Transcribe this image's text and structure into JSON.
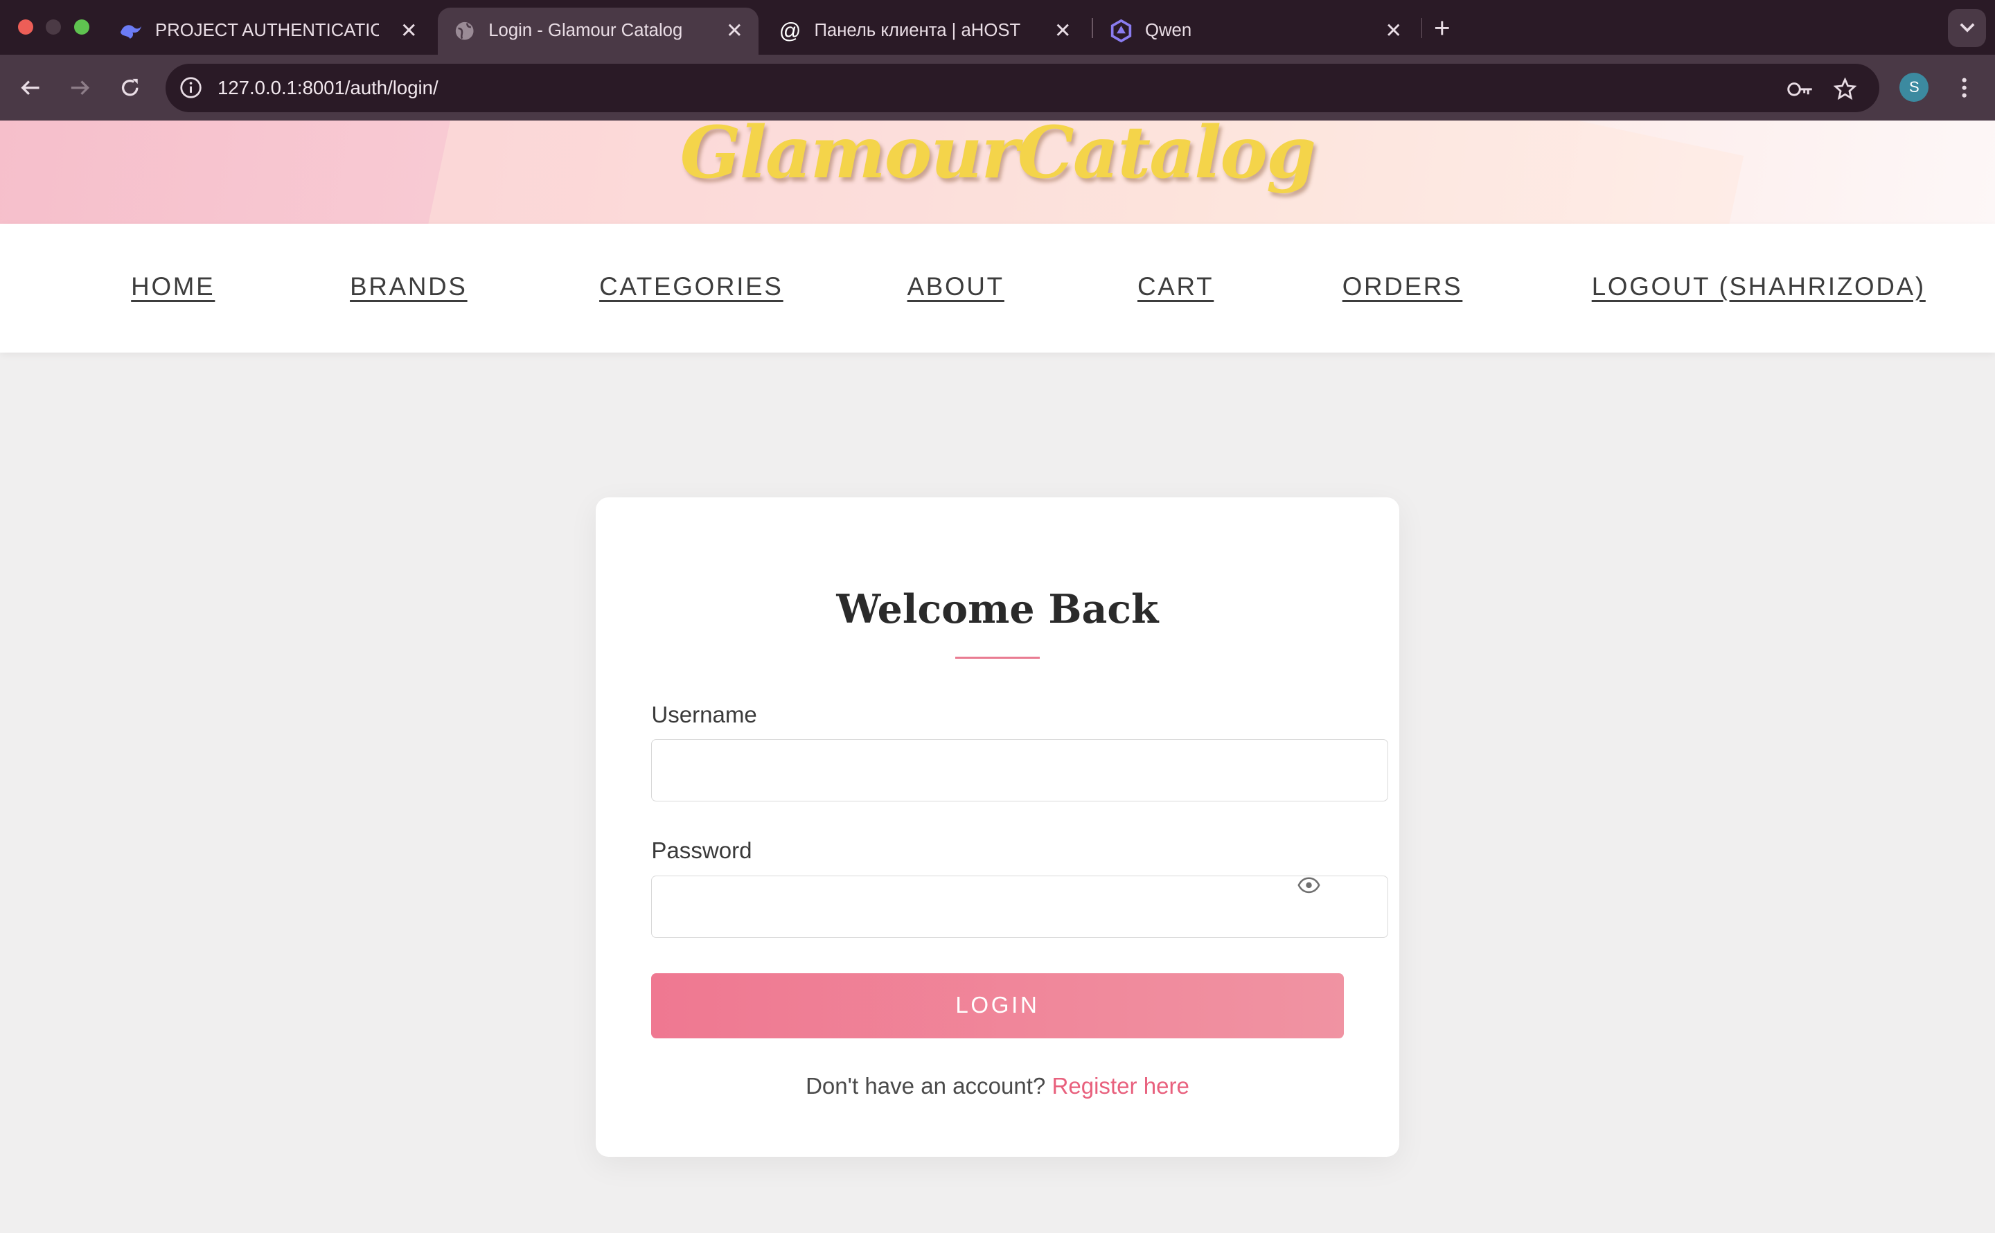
{
  "browser": {
    "tabs": [
      {
        "title": "PROJECT AUTHENTICATION",
        "icon": "deepseek-icon",
        "active": false
      },
      {
        "title": "Login - Glamour Catalog",
        "icon": "globe-icon",
        "active": true
      },
      {
        "title": "Панель клиента | aHOST",
        "icon": "at-sign-icon",
        "active": false
      },
      {
        "title": "Qwen",
        "icon": "qwen-icon",
        "active": false
      }
    ],
    "url": "127.0.0.1:8001/auth/login/",
    "profile_initial": "S"
  },
  "site": {
    "logo": "GlamourCatalog",
    "nav": [
      "HOME",
      "BRANDS",
      "CATEGORIES",
      "ABOUT",
      "CART",
      "ORDERS",
      "LOGOUT (SHAHRIZODA)"
    ]
  },
  "login": {
    "title": "Welcome Back",
    "username_label": "Username",
    "username_value": "",
    "password_label": "Password",
    "password_value": "",
    "button_label": "LOGIN",
    "register_prompt": "Don't have an account?",
    "register_link": "Register here"
  },
  "colors": {
    "accent": "#ef7891",
    "link": "#e8607d",
    "logo": "#f4d44a",
    "tabbar": "#2a1a26",
    "toolbar": "#4a3946"
  }
}
